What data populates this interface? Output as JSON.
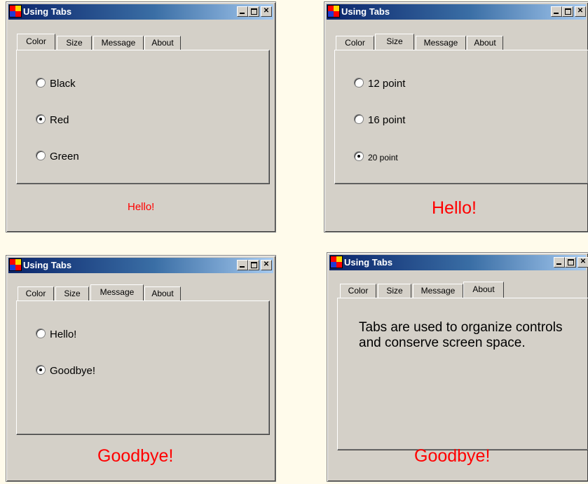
{
  "windows": [
    {
      "title": "Using Tabs",
      "tabs": [
        "Color",
        "Size",
        "Message",
        "About"
      ],
      "selected_tab": "Color",
      "options": [
        {
          "label": "Black",
          "checked": false
        },
        {
          "label": "Red",
          "checked": true
        },
        {
          "label": "Green",
          "checked": false
        }
      ],
      "output_text": "Hello!"
    },
    {
      "title": "Using Tabs",
      "tabs": [
        "Color",
        "Size",
        "Message",
        "About"
      ],
      "selected_tab": "Size",
      "options": [
        {
          "label": "12 point",
          "checked": false
        },
        {
          "label": "16 point",
          "checked": false
        },
        {
          "label": "20 point",
          "checked": true
        }
      ],
      "output_text": "Hello!"
    },
    {
      "title": "Using Tabs",
      "tabs": [
        "Color",
        "Size",
        "Message",
        "About"
      ],
      "selected_tab": "Message",
      "options": [
        {
          "label": "Hello!",
          "checked": false
        },
        {
          "label": "Goodbye!",
          "checked": true
        }
      ],
      "output_text": "Goodbye!"
    },
    {
      "title": "Using Tabs",
      "tabs": [
        "Color",
        "Size",
        "Message",
        "About"
      ],
      "selected_tab": "About",
      "about_text": "Tabs are used to organize controls and conserve screen space.",
      "output_text": "Goodbye!"
    }
  ],
  "colors": {
    "page_background": "#fffbeb",
    "window_face": "#d4d0c8",
    "titlebar_start": "#0a246a",
    "titlebar_end": "#a6caf0",
    "output_text": "#ff0000"
  },
  "icons": {
    "app": "app-icon",
    "minimize": "minimize-icon",
    "maximize": "maximize-icon",
    "close": "close-icon"
  }
}
